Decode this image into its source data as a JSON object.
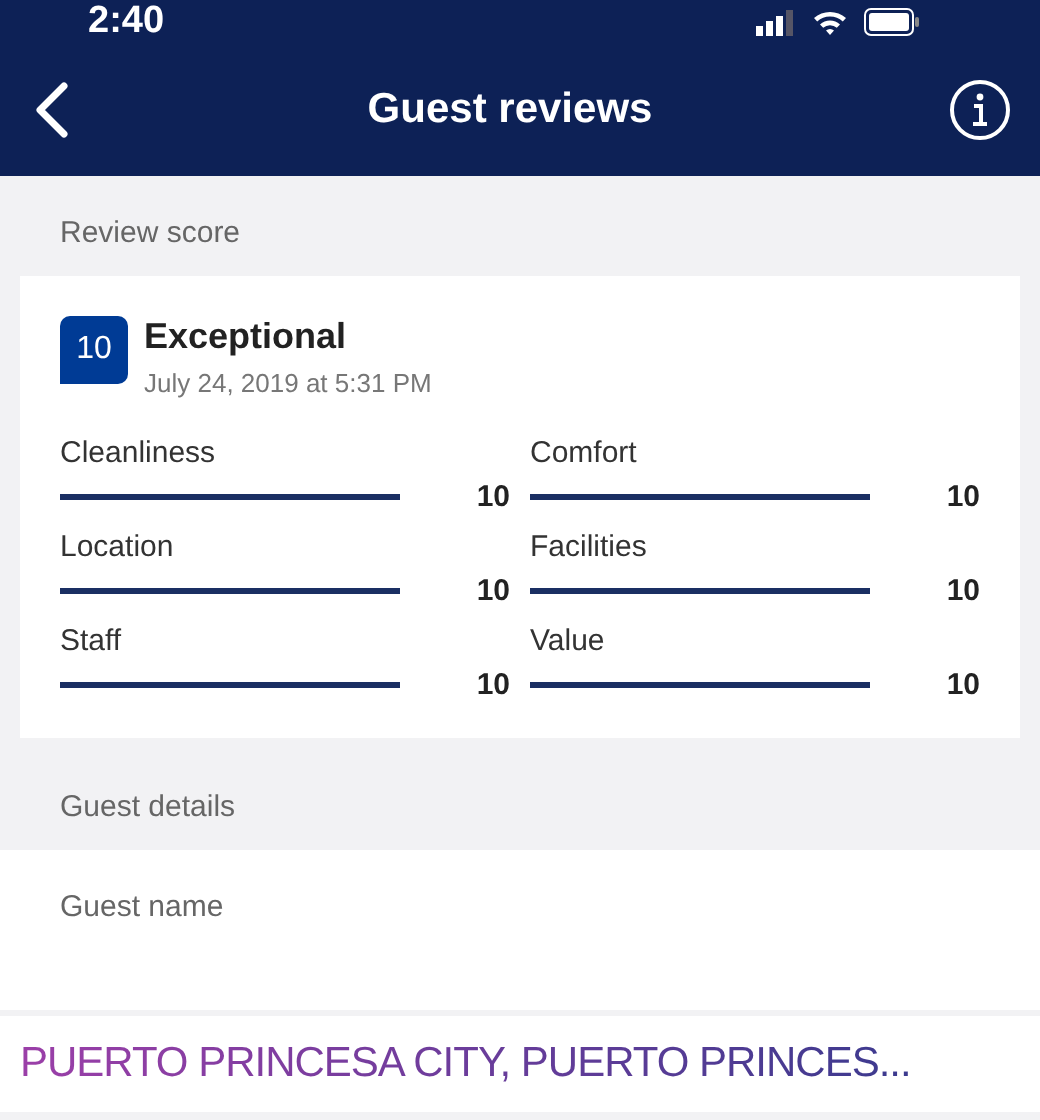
{
  "status_bar": {
    "time": "2:40"
  },
  "header": {
    "title": "Guest reviews"
  },
  "review_score": {
    "section_label": "Review score",
    "score": "10",
    "rating": "Exceptional",
    "date": "July 24, 2019 at 5:31 PM",
    "categories": [
      {
        "name": "Cleanliness",
        "level": 1,
        "score": "10"
      },
      {
        "name": "Comfort",
        "level": 1,
        "score": "10"
      },
      {
        "name": "Location",
        "level": 1,
        "score": "10"
      },
      {
        "name": "Facilities",
        "level": 1,
        "score": "10"
      },
      {
        "name": "Staff",
        "level": 1,
        "score": "10"
      },
      {
        "name": "Value",
        "level": 1,
        "score": "10"
      }
    ]
  },
  "guest_details": {
    "section_label": "Guest details",
    "fields": [
      {
        "label": "Guest name"
      }
    ]
  },
  "overlay_caption": "PUERTO PRINCESA CITY, PUERTO PRINCES..."
}
